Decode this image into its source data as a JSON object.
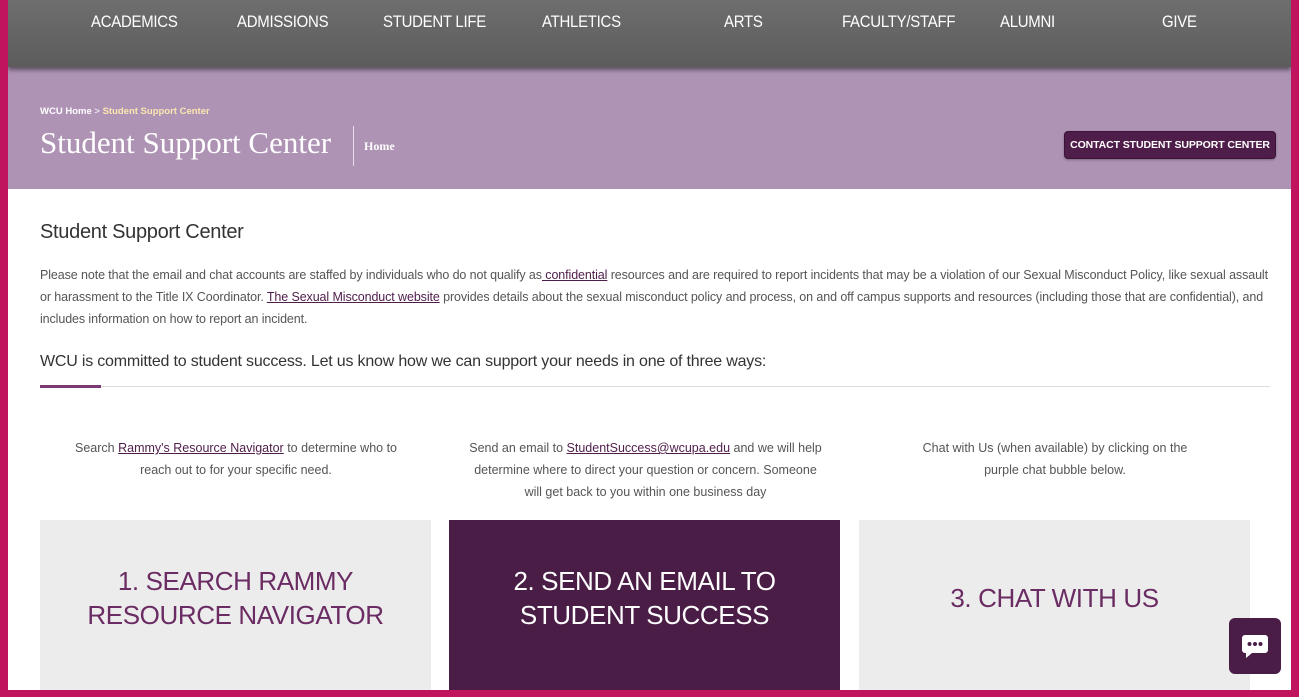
{
  "nav": {
    "items": [
      "ACADEMICS",
      "ADMISSIONS",
      "STUDENT LIFE",
      "ATHLETICS",
      "ARTS",
      "FACULTY/STAFF",
      "ALUMNI",
      "GIVE"
    ]
  },
  "header": {
    "breadcrumb_home": "WCU Home",
    "breadcrumb_sep": " > ",
    "breadcrumb_current": "Student Support Center",
    "title": "Student Support Center",
    "home_link": "Home",
    "contact_button": "CONTACT STUDENT SUPPORT CENTER"
  },
  "main": {
    "heading": "Student Support Center",
    "notice": {
      "part1": "Please note that the email and chat accounts are staffed by individuals who do not qualify as",
      "link1": " confidential",
      "part2": " resources and are required to report incidents that may be a violation of our Sexual Misconduct Policy, like sexual assault or harassment to the Title IX Coordinator.  ",
      "link2": "The Sexual Misconduct website",
      "part3": " provides details about the sexual misconduct policy and process, on and off campus supports and resources (including those that are confidential),  and includes information on how to report an incident."
    },
    "commitment": "WCU is committed to student success. Let us know how we can support your needs in one of three ways:",
    "columns": [
      {
        "pre": "Search ",
        "link": "Rammy's Resource Navigator",
        "post": " to determine who to reach out to for your specific need.",
        "card": "1. SEARCH RAMMY RESOURCE NAVIGATOR"
      },
      {
        "pre": "Send an email to ",
        "link": "StudentSuccess@wcupa.edu",
        "post": " and we will help determine where to direct your question or concern. Someone will get back to you within one business day",
        "card": "2. SEND AN EMAIL TO STUDENT SUCCESS"
      },
      {
        "pre": "Chat with Us (when available) by clicking on the purple chat bubble below.",
        "link": "",
        "post": "",
        "card": "3. CHAT WITH US"
      }
    ]
  },
  "chat": {
    "icon": "chat-bubble-icon"
  },
  "colors": {
    "accent": "#4a1d47",
    "band": "#ae93b5",
    "frame": "#c1145f",
    "nav": "#666666"
  }
}
